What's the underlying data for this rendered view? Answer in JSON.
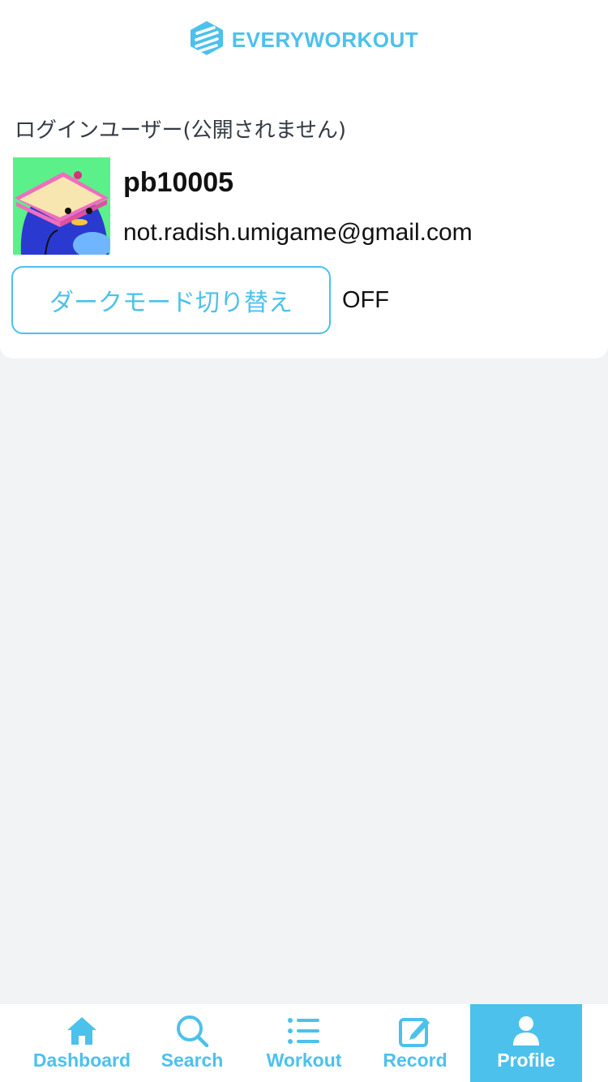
{
  "header": {
    "logo_text": "EVERYWORKOUT",
    "logo_icon": "stripes-logo-icon",
    "brand_color": "#4cc1ec"
  },
  "profile": {
    "section_label": "ログインユーザー(公開されません)",
    "avatar_icon": "penguin-with-book-avatar",
    "username": "pb10005",
    "email": "not.radish.umigame@gmail.com",
    "dark_mode_button_label": "ダークモード切り替え",
    "dark_mode_state": "OFF"
  },
  "tabbar": {
    "tabs": [
      {
        "label": "Dashboard",
        "icon": "home-icon",
        "active": false
      },
      {
        "label": "Search",
        "icon": "search-icon",
        "active": false
      },
      {
        "label": "Workout",
        "icon": "list-icon",
        "active": false
      },
      {
        "label": "Record",
        "icon": "edit-icon",
        "active": false
      },
      {
        "label": "Profile",
        "icon": "user-icon",
        "active": true
      }
    ]
  }
}
